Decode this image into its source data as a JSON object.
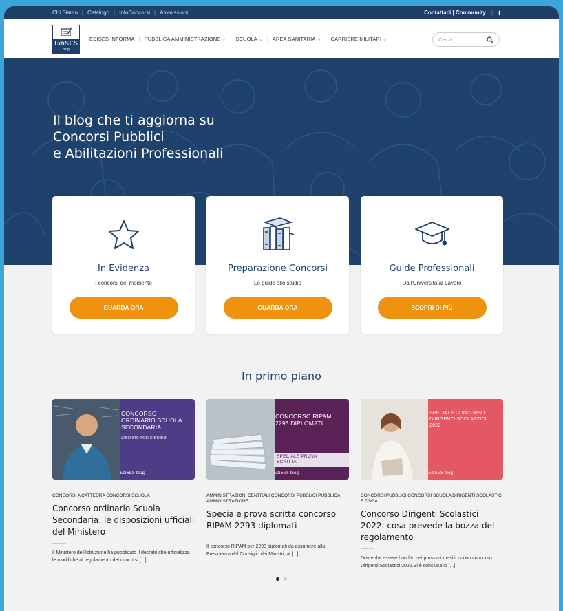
{
  "topbar": {
    "links": [
      "Chi Siamo",
      "Catalogo",
      "InfoConcorsi",
      "Ammissioni"
    ],
    "right": "Contattaci | Community",
    "social": "f"
  },
  "header": {
    "logo_name": "EdiSES",
    "logo_sub": "blog",
    "nav": [
      {
        "label": "EDISES INFORMA",
        "dropdown": false
      },
      {
        "label": "PUBBLICA AMMINISTRAZIONE",
        "dropdown": true
      },
      {
        "label": "SCUOLA",
        "dropdown": true
      },
      {
        "label": "AREA SANITARIA",
        "dropdown": true
      },
      {
        "label": "CARRIERE MILITARI",
        "dropdown": true
      }
    ],
    "search_placeholder": "Cerca..."
  },
  "hero": {
    "line1": "Il blog che ti aggiorna su",
    "line2": "Concorsi Pubblici",
    "line3": "e Abilitazioni Professionali"
  },
  "cards": [
    {
      "icon": "star-icon",
      "title": "In Evidenza",
      "subtitle": "I concorsi del momento",
      "button": "GUARDA ORA"
    },
    {
      "icon": "books-icon",
      "title": "Preparazione Concorsi",
      "subtitle": "Le guide allo studio",
      "button": "GUARDA ORA"
    },
    {
      "icon": "graduation-cap-icon",
      "title": "Guide Professionali",
      "subtitle": "Dall'Università al Lavoro",
      "button": "SCOPRI DI PIÙ"
    }
  ],
  "section_title": "In primo piano",
  "posts": [
    {
      "thumb_text": "CONCORSO ORDINARIO SCUOLA SECONDARIA",
      "thumb_sub": "Decreto Ministeriale",
      "thumb_brand": "EdiSES blog",
      "thumb_color": "#4c3d86",
      "category": "CONCORSI A CATTEDRA CONCORSI SCUOLA",
      "title": "Concorso ordinario Scuola Secondaria: le disposizioni ufficiali del Ministero",
      "excerpt": "Il Ministero dell'Istruzione ha pubblicato il decreto che ufficializza le modifiche al regolamento dei concorsi [...]"
    },
    {
      "thumb_text": "CONCORSO RIPAM 2293 DIPLOMATI",
      "thumb_sub": "SPECIALE PROVA SCRITTA",
      "thumb_brand": "EdiSES blog",
      "thumb_color": "#5a2256",
      "category": "AMMINISTRAZIONI CENTRALI CONCORSI PUBBLICI PUBBLICA AMMINISTRAZIONE",
      "title": "Speciale prova scritta concorso RIPAM 2293 diplomati",
      "excerpt": "Il concorso RIPAM per 2293 diplomati da assumere alla Presidenza del Consiglio dei Ministri, al [...]"
    },
    {
      "thumb_text": "SPECIALE CONCORSO DIRIGENTI SCOLASTICI 2022",
      "thumb_sub": "",
      "thumb_brand": "EdiSES blog",
      "thumb_color": "#e35862",
      "category": "CONCORSI PUBBLICI CONCORSI SCUOLA DIRIGENTI SCOLASTICI E DSGA",
      "title": "Concorso Dirigenti Scolastici 2022: cosa prevede la bozza del regolamento",
      "excerpt": "Dovrebbe essere bandito nei prossimi mesi il nuovo concorso Dirigenti Scolastici 2022.Si è conclusa lo [...]"
    }
  ],
  "slider": {
    "count": 2,
    "active": 1
  },
  "colors": {
    "navy": "#1d3f6a",
    "accent": "#ef920e",
    "page_bg": "#3aa6d9"
  }
}
